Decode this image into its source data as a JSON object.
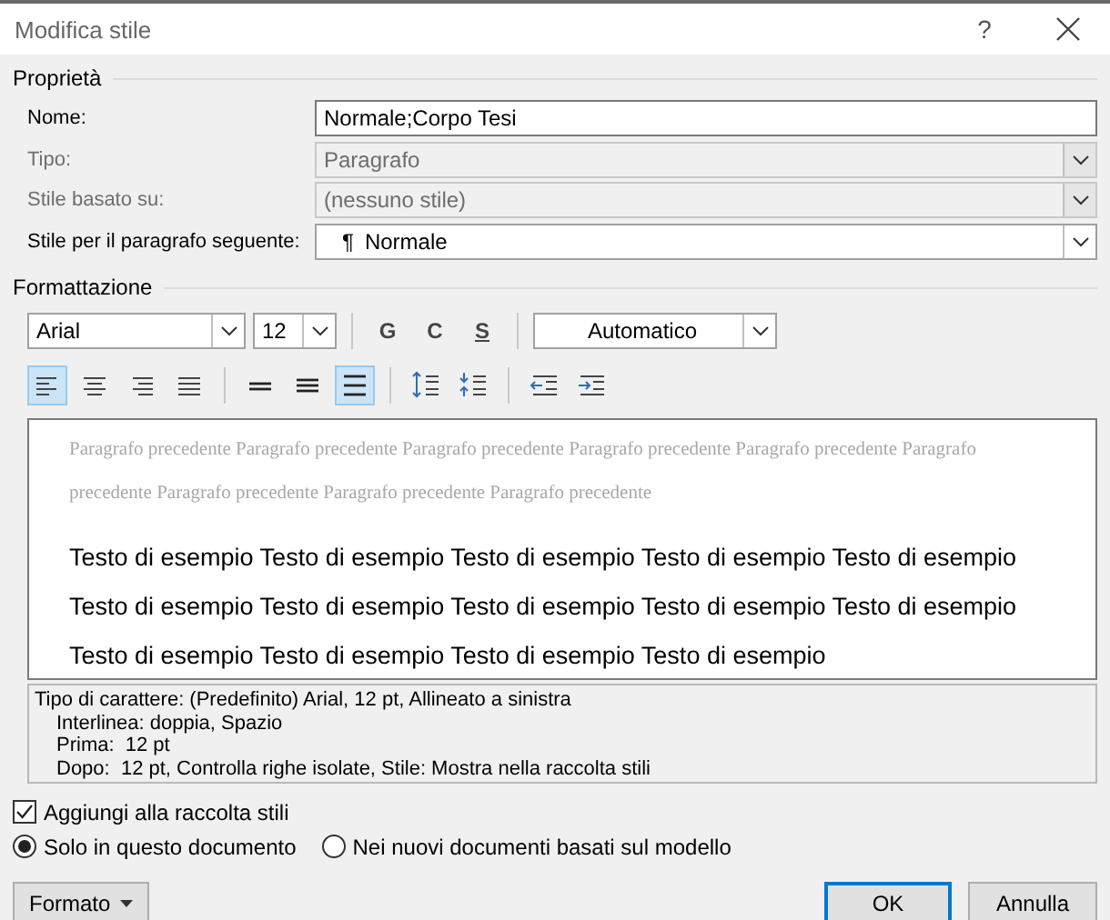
{
  "window": {
    "title": "Modifica stile",
    "help": "?"
  },
  "properties": {
    "heading": "Proprietà",
    "fields": [
      {
        "label": "Nome:",
        "value": "Normale;Corpo Tesi",
        "kind": "text",
        "disabled": false
      },
      {
        "label": "Tipo:",
        "value": "Paragrafo",
        "kind": "dropdown",
        "disabled": true
      },
      {
        "label": "Stile basato su:",
        "value": "(nessuno stile)",
        "kind": "dropdown",
        "disabled": true
      },
      {
        "label": "Stile per il paragrafo seguente:",
        "prefix": "¶",
        "value": "Normale",
        "kind": "dropdown",
        "disabled": false
      }
    ]
  },
  "formatting": {
    "heading": "Formattazione",
    "font": "Arial",
    "size": "12",
    "style_buttons": [
      "G",
      "C",
      "S"
    ],
    "text_color": "Automatico",
    "alignment": [
      {
        "kind": "left",
        "selected": true
      },
      {
        "kind": "center",
        "selected": false
      },
      {
        "kind": "right",
        "selected": false
      },
      {
        "kind": "justify",
        "selected": false
      }
    ],
    "line_spacing": [
      {
        "kind": "single",
        "selected": false
      },
      {
        "kind": "one-half",
        "selected": false
      },
      {
        "kind": "double",
        "selected": true
      }
    ],
    "paragraph_spacing": [
      {
        "kind": "increase"
      },
      {
        "kind": "decrease"
      }
    ],
    "indent": [
      {
        "kind": "decrease"
      },
      {
        "kind": "increase"
      }
    ]
  },
  "preview": {
    "previous": "Paragrafo precedente Paragrafo precedente Paragrafo precedente Paragrafo precedente Paragrafo precedente Paragrafo precedente Paragrafo precedente Paragrafo precedente Paragrafo precedente",
    "sample": [
      "Testo di esempio Testo di esempio Testo di esempio Testo di esempio Testo di esempio",
      "Testo di esempio Testo di esempio Testo di esempio Testo di esempio Testo di esempio",
      "Testo di esempio Testo di esempio Testo di esempio Testo di esempio"
    ]
  },
  "description": [
    "Tipo di carattere: (Predefinito) Arial, 12 pt, Allineato a sinistra",
    "Interlinea: doppia, Spazio",
    "Prima:  12 pt",
    "Dopo:  12 pt, Controlla righe isolate, Stile: Mostra nella raccolta stili"
  ],
  "options": {
    "add_to_gallery": {
      "label": "Aggiungi alla raccolta stili",
      "checked": true
    },
    "scope": [
      {
        "label": "Solo in questo documento",
        "selected": true
      },
      {
        "label": "Nei nuovi documenti basati sul modello",
        "selected": false
      }
    ]
  },
  "buttons": {
    "format": "Formato",
    "ok": "OK",
    "cancel": "Annulla"
  }
}
